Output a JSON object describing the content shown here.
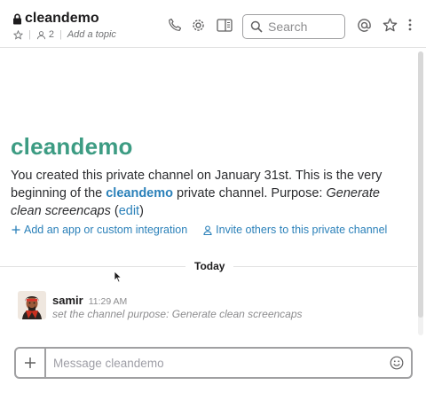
{
  "header": {
    "channel_name": "cleandemo",
    "member_count": "2",
    "topic_placeholder": "Add a topic",
    "search_placeholder": "Search"
  },
  "intro": {
    "title": "cleandemo",
    "line_start": "You created this private channel on January 31st. This is the very beginning of the ",
    "channel_link": "cleandemo",
    "line_mid": " private channel. Purpose: ",
    "purpose": "Generate clean screencaps",
    "paren_open": " (",
    "edit_link": "edit",
    "paren_close": ")",
    "add_app": "Add an app or custom integration",
    "invite": "Invite others to this private channel"
  },
  "divider": {
    "label": "Today"
  },
  "message": {
    "author": "samir",
    "time": "11:29 AM",
    "body": "set the channel purpose: Generate clean screencaps"
  },
  "composer": {
    "placeholder": "Message cleandemo"
  },
  "colors": {
    "accent_green": "#3d9c83",
    "link_blue": "#2a80b9",
    "muted": "#8d8d8f"
  },
  "icons": [
    "lock-icon",
    "star-icon",
    "member-icon",
    "phone-icon",
    "gear-icon",
    "sidebar-toggle-icon",
    "search-icon",
    "mention-icon",
    "starred-icon",
    "more-icon",
    "plus-icon",
    "person-icon",
    "emoji-icon"
  ]
}
